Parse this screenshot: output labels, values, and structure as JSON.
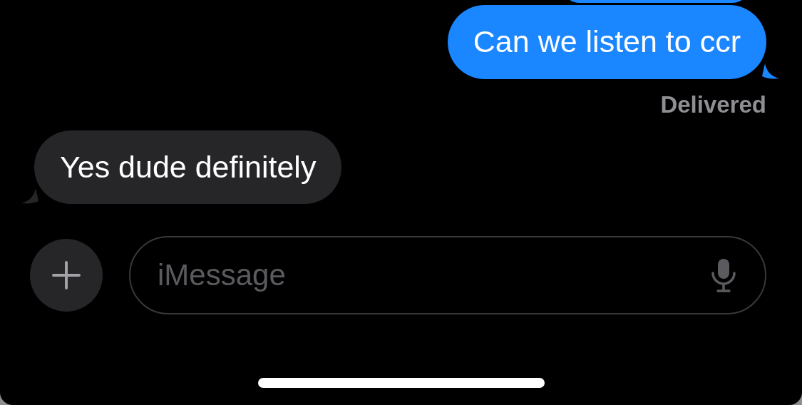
{
  "messages": [
    {
      "kind": "sent",
      "text": "Can we listen to ccr"
    },
    {
      "kind": "received",
      "text": "Yes dude definitely"
    }
  ],
  "status": "Delivered",
  "composer": {
    "placeholder": "iMessage"
  }
}
